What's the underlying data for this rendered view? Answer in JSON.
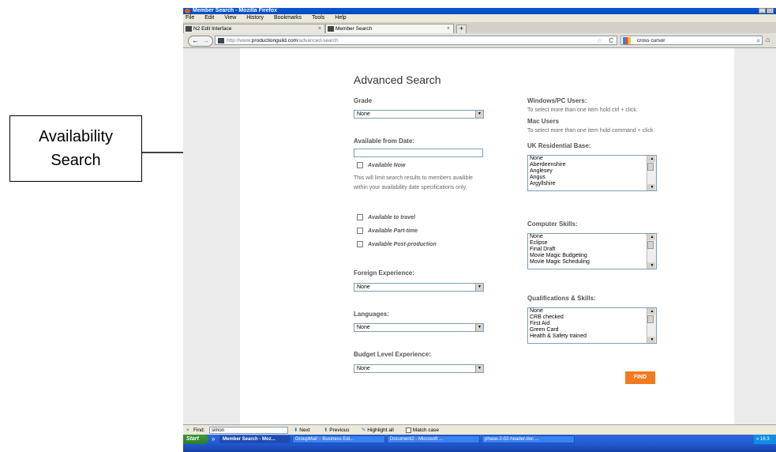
{
  "annotation": {
    "line1": "Availability",
    "line2": "Search"
  },
  "window": {
    "title": "Member Search - Mozilla Firefox",
    "controls": [
      "_",
      "□",
      "X"
    ]
  },
  "menu": [
    "File",
    "Edit",
    "View",
    "History",
    "Bookmarks",
    "Tools",
    "Help"
  ],
  "tabs": [
    {
      "label": "N2 Edit Interface",
      "close": "×"
    },
    {
      "label": "Member Search",
      "close": "×"
    }
  ],
  "newtab": "+",
  "nav": {
    "back": "←",
    "forward": "→",
    "url_prefix": "http://www.",
    "url_domain": "productionguild.com",
    "url_path": "/advanced-search",
    "star": "☆",
    "reload": "C",
    "search_value": "cross cursor",
    "search_glyph": "⌕",
    "home": "⌂"
  },
  "page": {
    "title": "Advanced Search",
    "grade": {
      "label": "Grade",
      "value": "None"
    },
    "available_from": {
      "label": "Available from Date:",
      "value": ""
    },
    "available_now": "Available Now",
    "note_line1": "This will limit search results to members availible",
    "note_line2": "within your availability date specifications only.",
    "checks": [
      "Available to travel",
      "Available Part-time",
      "Available Post-production"
    ],
    "foreign": {
      "label": "Foreign Experience:",
      "value": "None"
    },
    "languages": {
      "label": "Languages:",
      "value": "None"
    },
    "budget": {
      "label": "Budget Level Experience:",
      "value": "None"
    },
    "win_users": {
      "label": "Windows/PC Users:",
      "hint": "To select more than one item hold ctrl + click."
    },
    "mac_users": {
      "label": "Mac Users",
      "hint": "To select more than one item hold command + click."
    },
    "uk_base": {
      "label": "UK Residential Base:",
      "options": [
        "None",
        "Aberdeenshire",
        "Anglesey",
        "Angus",
        "Argyllshire"
      ]
    },
    "computer": {
      "label": "Computer Skills:",
      "options": [
        "None",
        "Eclipse",
        "Final Draft",
        "Movie Magic Budgeting",
        "Movie Magic Scheduling"
      ]
    },
    "quals": {
      "label": "Qualifications & Skills:",
      "options": [
        "None",
        "CRB checked",
        "First Aid",
        "Green Card",
        "Health & Safety trained"
      ]
    },
    "find": "FIND"
  },
  "findbar": {
    "close": "×",
    "label": "Find:",
    "value": "simon",
    "next": "Next",
    "previous": "Previous",
    "highlight": "Highlight all",
    "match": "Match case"
  },
  "taskbar": {
    "start": "Start",
    "quicklaunch": "»",
    "items": [
      "Member Search - Moz...",
      "GroupMail :: Business Edi...",
      "Document2 - Microsoft ...",
      "phase-2-02-header.doc ..."
    ],
    "clock": "« 16:3"
  }
}
